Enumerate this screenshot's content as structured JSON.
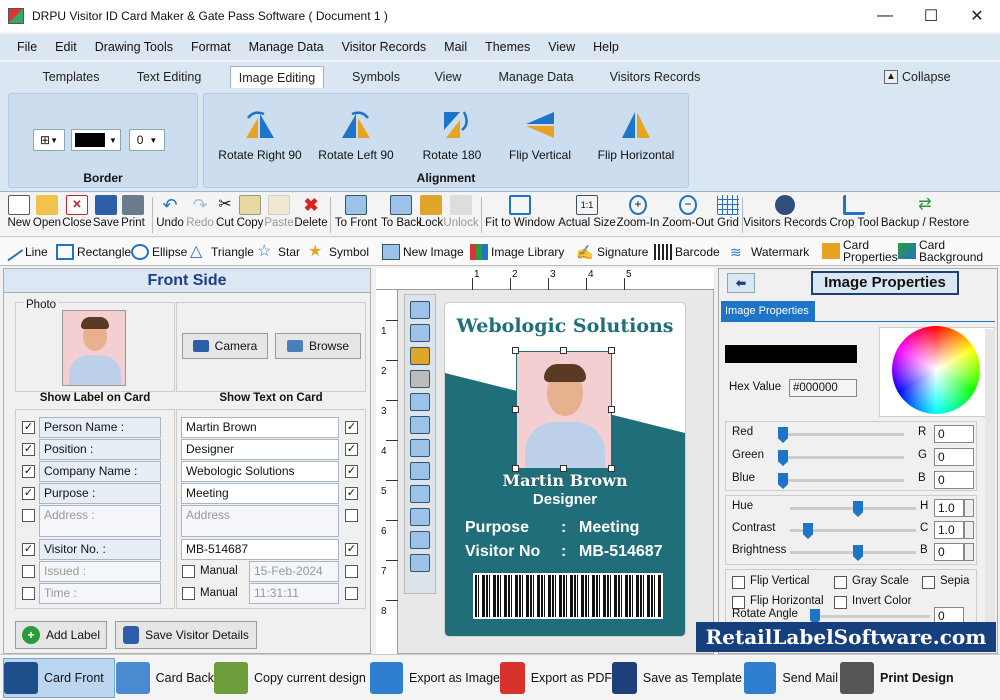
{
  "window": {
    "title": "DRPU Visitor ID Card Maker & Gate Pass Software ( Document 1 )",
    "controls": {
      "minimize": "—",
      "maximize": "☐",
      "close": "✕"
    }
  },
  "menu": [
    "File",
    "Edit",
    "Drawing Tools",
    "Format",
    "Manage Data",
    "Visitor Records",
    "Mail",
    "Themes",
    "View",
    "Help"
  ],
  "ribbon_tabs": [
    "Templates",
    "Text Editing",
    "Image Editing",
    "Symbols",
    "View",
    "Manage Data",
    "Visitors Records"
  ],
  "ribbon_active_tab": "Image Editing",
  "collapse_label": "Collapse",
  "ribbon": {
    "border_group_label": "Border",
    "border_width_value": "0",
    "alignment_group_label": "Alignment",
    "alignment_buttons": [
      "Rotate Right 90",
      "Rotate Left 90",
      "Rotate 180",
      "Flip Vertical",
      "Flip Horizontal"
    ]
  },
  "toolbar": {
    "file": [
      "New",
      "Open",
      "Close",
      "Save",
      "Print"
    ],
    "edit": [
      "Undo",
      "Redo",
      "Cut",
      "Copy",
      "Paste",
      "Delete"
    ],
    "arrange": [
      "To Front",
      "To Back",
      "Lock",
      "Unlock"
    ],
    "zoom": [
      "Fit to Window",
      "Actual Size",
      "Zoom-In",
      "Zoom-Out",
      "Grid"
    ],
    "tools": [
      "Visitors Records",
      "Crop Tool",
      "Backup / Restore"
    ]
  },
  "drawbar": [
    "Line",
    "Rectangle",
    "Ellipse",
    "Triangle",
    "Star",
    "Symbol",
    "New Image",
    "Image Library",
    "Signature",
    "Barcode",
    "Watermark",
    "Card Properties",
    "Card Background"
  ],
  "left_panel": {
    "header": "Front Side",
    "photo_label": "Photo",
    "camera_button": "Camera",
    "browse_button": "Browse",
    "show_label_heading": "Show Label on Card",
    "show_text_heading": "Show Text on Card",
    "rows": [
      {
        "label": "Person Name :",
        "value": "Martin Brown",
        "label_checked": true,
        "text_checked": true,
        "enabled": true
      },
      {
        "label": "Position :",
        "value": "Designer",
        "label_checked": true,
        "text_checked": true,
        "enabled": true
      },
      {
        "label": "Company Name :",
        "value": "Webologic Solutions",
        "label_checked": true,
        "text_checked": true,
        "enabled": true
      },
      {
        "label": "Purpose :",
        "value": "Meeting",
        "label_checked": true,
        "text_checked": true,
        "enabled": true
      },
      {
        "label": "Address :",
        "value": "Address",
        "label_checked": false,
        "text_checked": false,
        "enabled": false
      },
      {
        "label": "Visitor No. :",
        "value": "MB-514687",
        "label_checked": true,
        "text_checked": true,
        "enabled": true
      },
      {
        "label": "Issued :",
        "value": "15-Feb-2024",
        "manual": "Manual",
        "label_checked": false,
        "text_checked": false,
        "enabled": false
      },
      {
        "label": "Time :",
        "value": "11:31:11",
        "manual": "Manual",
        "label_checked": false,
        "text_checked": false,
        "enabled": false
      }
    ],
    "add_label_button": "Add Label",
    "save_visitor_button": "Save Visitor Details"
  },
  "ruler": {
    "h_marks": [
      "1",
      "2",
      "3",
      "4",
      "5"
    ],
    "v_marks": [
      "1",
      "2",
      "3",
      "4",
      "5",
      "6",
      "7",
      "8"
    ]
  },
  "card": {
    "company": "Webologic Solutions",
    "name": "Martin Brown",
    "position": "Designer",
    "purpose_label": "Purpose",
    "purpose_value": "Meeting",
    "visitor_label": "Visitor No",
    "visitor_value": "MB-514687",
    "separator": ":",
    "teal": "#1f6e7a"
  },
  "right_panel": {
    "title": "Image Properties",
    "tab": "Image Properties",
    "hex_label": "Hex Value",
    "hex_value": "#000000",
    "rgb": [
      {
        "name": "Red",
        "letter": "R",
        "value": "0"
      },
      {
        "name": "Green",
        "letter": "G",
        "value": "0"
      },
      {
        "name": "Blue",
        "letter": "B",
        "value": "0"
      }
    ],
    "adjust": [
      {
        "name": "Hue",
        "letter": "H",
        "value": "1.0",
        "level": 0.5
      },
      {
        "name": "Contrast",
        "letter": "C",
        "value": "1.0",
        "level": 0.1
      },
      {
        "name": "Brightness",
        "letter": "B",
        "value": "0",
        "level": 0.5
      }
    ],
    "options": [
      "Flip Vertical",
      "Gray Scale",
      "Sepia",
      "Flip Horizontal",
      "Invert Color"
    ],
    "rotate_label": "Rotate Angle",
    "rotate_value": "0"
  },
  "watermark": "RetailLabelSoftware.com",
  "bottom_bar": [
    "Card Front",
    "Card Back",
    "Copy current design",
    "Export as Image",
    "Export as PDF",
    "Save as Template",
    "Send Mail",
    "Print Design"
  ],
  "colors": {
    "accent": "#1e74c7",
    "ribbon": "#dbe6f3",
    "card_teal": "#1f6e7a",
    "watermark_bg": "#163f7e"
  }
}
